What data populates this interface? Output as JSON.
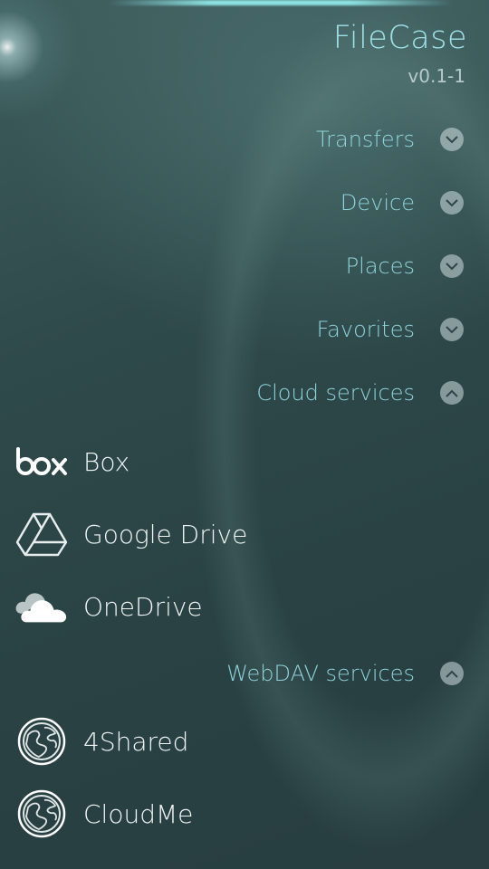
{
  "header": {
    "title": "FileCase",
    "version": "v0.1-1"
  },
  "sections": [
    {
      "label": "Transfers",
      "expanded": false
    },
    {
      "label": "Device",
      "expanded": false
    },
    {
      "label": "Places",
      "expanded": false
    },
    {
      "label": "Favorites",
      "expanded": false
    },
    {
      "label": "Cloud services",
      "expanded": true
    },
    {
      "label": "WebDAV services",
      "expanded": true
    }
  ],
  "cloud_services": [
    {
      "label": "Box",
      "icon": "box-logo-icon"
    },
    {
      "label": "Google Drive",
      "icon": "google-drive-icon"
    },
    {
      "label": "OneDrive",
      "icon": "onedrive-cloud-icon"
    }
  ],
  "webdav_services": [
    {
      "label": "4Shared",
      "icon": "globe-icon"
    },
    {
      "label": "CloudMe",
      "icon": "globe-icon"
    }
  ],
  "colors": {
    "accent": "#8fd4dc",
    "title": "#9fe0e6",
    "text": "#f1f5f5",
    "background": "#2b4446"
  }
}
